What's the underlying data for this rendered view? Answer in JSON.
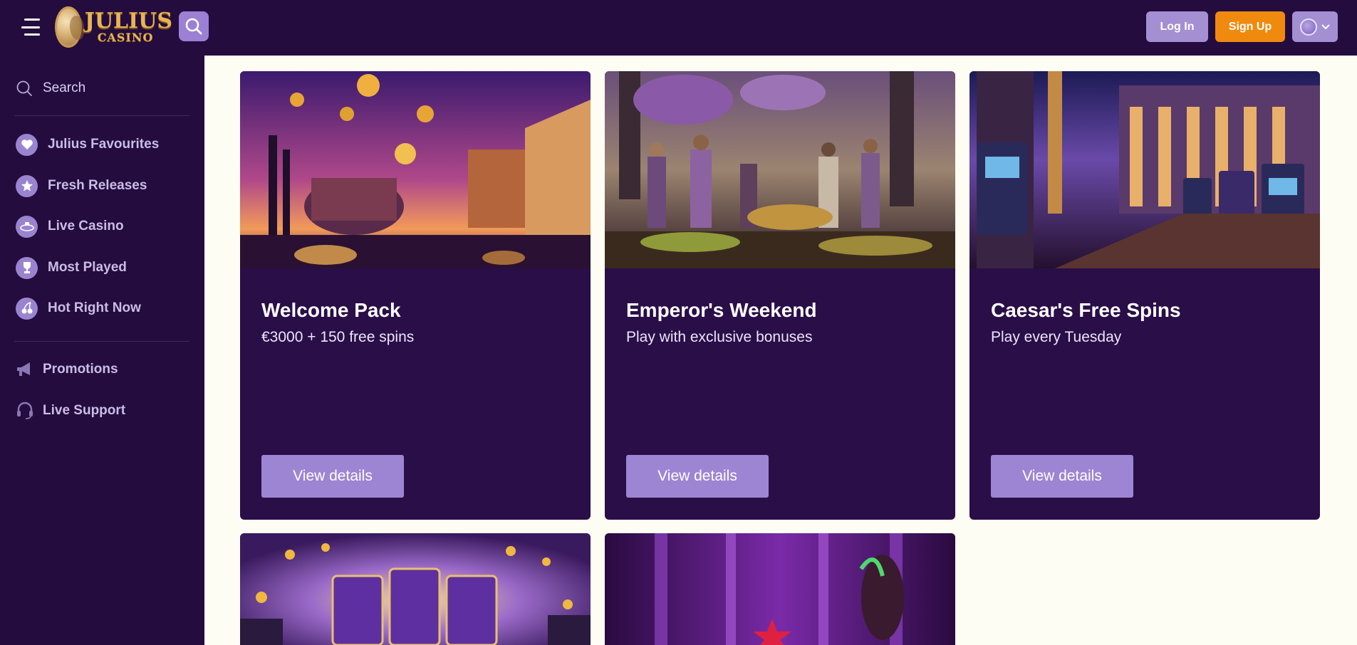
{
  "header": {
    "logo_line1": "JULIUS",
    "logo_line2": "CASINO",
    "login_label": "Log In",
    "signup_label": "Sign Up",
    "icons": [
      "menu-icon",
      "search-icon",
      "globe-icon",
      "chevron-down-icon"
    ]
  },
  "sidebar": {
    "search_label": "Search",
    "items": [
      {
        "label": "Julius Favourites",
        "icon": "heart-icon"
      },
      {
        "label": "Fresh Releases",
        "icon": "star-icon"
      },
      {
        "label": "Live Casino",
        "icon": "live-casino-icon"
      },
      {
        "label": "Most Played",
        "icon": "trophy-icon"
      },
      {
        "label": "Hot Right Now",
        "icon": "cherries-icon"
      }
    ],
    "links": [
      {
        "label": "Promotions",
        "icon": "megaphone-icon"
      },
      {
        "label": "Live Support",
        "icon": "headset-icon"
      }
    ]
  },
  "promotions": [
    {
      "title": "Welcome Pack",
      "subtitle": "€3000 + 150 free spins",
      "button": "View details"
    },
    {
      "title": "Emperor's Weekend",
      "subtitle": "Play with exclusive bonuses",
      "button": "View details"
    },
    {
      "title": "Caesar's Free Spins",
      "subtitle": "Play every Tuesday",
      "button": "View details"
    }
  ],
  "colors": {
    "header_bg": "#240c3e",
    "card_bg": "#2a0e48",
    "accent_purple": "#9d85d3",
    "signup_orange": "#f08a0e",
    "page_bg": "#fdfdf3"
  }
}
